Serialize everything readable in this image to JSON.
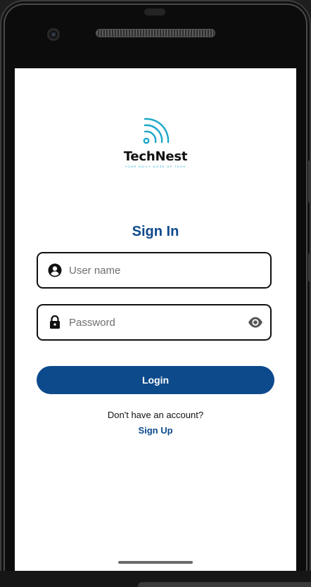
{
  "brand": {
    "name": "TechNest",
    "tagline": "YOUR DAILY DOSE OF TECH",
    "icon": "wifi-signal-icon",
    "accent": "#1aa7c8"
  },
  "signin": {
    "title": "Sign In",
    "username": {
      "value": "",
      "placeholder": "User name",
      "icon": "user-circle-icon"
    },
    "password": {
      "value": "",
      "placeholder": "Password",
      "icon": "lock-icon",
      "toggle_icon": "eye-icon"
    },
    "login_label": "Login",
    "no_account_text": "Don't have an account?",
    "signup_label": "Sign Up"
  },
  "colors": {
    "primary": "#0d4a8c",
    "text": "#111111",
    "screen_bg": "#ffffff"
  }
}
